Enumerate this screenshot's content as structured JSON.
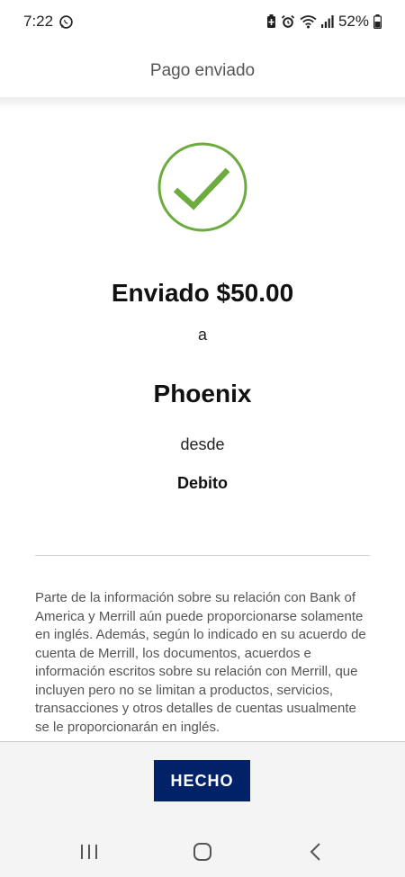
{
  "status_bar": {
    "time": "7:22",
    "battery": "52%",
    "icons": [
      "whatsapp-icon",
      "battery-saver-icon",
      "alarm-icon",
      "wifi-icon",
      "signal-icon",
      "battery-icon"
    ]
  },
  "header": {
    "title": "Pago enviado"
  },
  "confirmation": {
    "icon": "check-circle-icon",
    "accent_color": "#6cac3e",
    "amount_text": "Enviado $50.00",
    "to_text": "a",
    "recipient": "Phoenix",
    "from_text": "desde",
    "account": "Debito"
  },
  "disclaimer": {
    "text": "Parte de la información sobre su relación con Bank of America y Merrill aún puede proporcionarse solamente en inglés. Además, según lo indicado en su acuerdo de cuenta de Merrill, los documentos, acuerdos e información escritos sobre su relación con Merrill, que incluyen pero no se limitan a productos, servicios, transacciones y otros detalles de cuentas usualmente se le proporcionarán en inglés."
  },
  "footer": {
    "done_label": "HECHO",
    "button_color": "#012169"
  },
  "nav_bar": {
    "icons": [
      "recent-apps-icon",
      "home-icon",
      "back-icon"
    ]
  }
}
